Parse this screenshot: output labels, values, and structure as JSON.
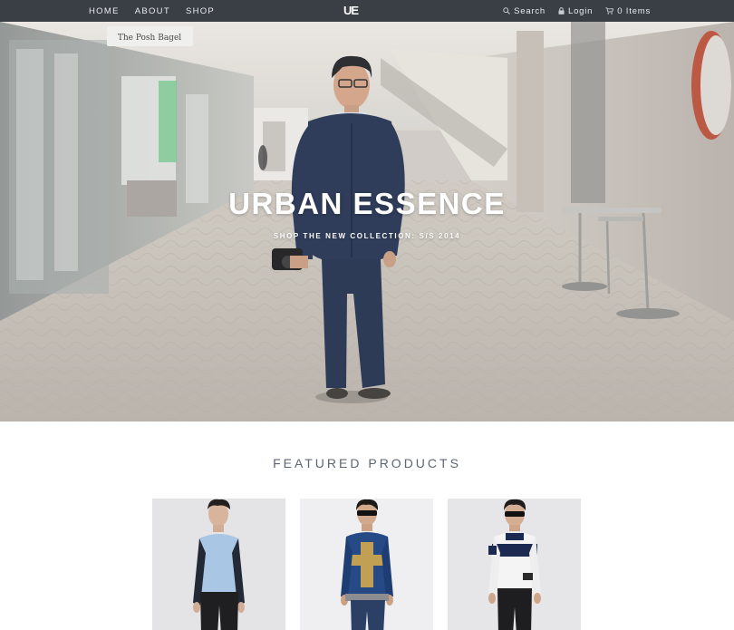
{
  "nav": {
    "links": [
      "HOME",
      "ABOUT",
      "SHOP"
    ],
    "logo_text": "UE",
    "search_label": "Search",
    "login_label": "Login",
    "cart_label": "0 Items"
  },
  "hero": {
    "title": "URBAN ESSENCE",
    "subtitle": "SHOP THE NEW COLLECTION: S/S 2014"
  },
  "featured": {
    "title": "FEATURED PRODUCTS",
    "products": [
      {
        "image": "light-blue-shirt-model"
      },
      {
        "image": "denim-jacket-cross-model"
      },
      {
        "image": "white-navy-shirt-model"
      }
    ]
  },
  "colors": {
    "nav_bg": "#3a3f45",
    "nav_text": "#e9ecef",
    "heading_text": "#5d6670",
    "background": "#ffffff"
  }
}
